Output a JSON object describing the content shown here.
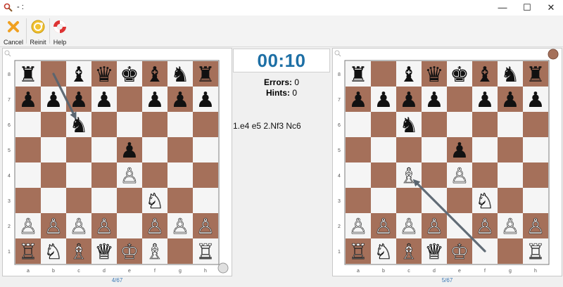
{
  "window": {
    "title": "- :",
    "minimize": "—",
    "maximize": "☐",
    "close": "✕"
  },
  "toolbar": {
    "cancel_label": "Cancel",
    "reinit_label": "Reinit",
    "help_label": "Help"
  },
  "timer": "00:10",
  "stats": {
    "errors_label": "Errors:",
    "errors_value": "0",
    "hints_label": "Hints:",
    "hints_value": "0"
  },
  "moves": "1.e4 e5 2.Nf3 Nc6",
  "files": [
    "a",
    "b",
    "c",
    "d",
    "e",
    "f",
    "g",
    "h"
  ],
  "ranks": [
    "8",
    "7",
    "6",
    "5",
    "4",
    "3",
    "2",
    "1"
  ],
  "colors": {
    "light": "#f5f5f5",
    "dark": "#a5705a",
    "arrow": "#5a6570",
    "accent": "#1d6fa5"
  },
  "left_board": {
    "page": "4/67",
    "position": [
      "r.bqkbnr",
      "pppp.ppp",
      "..n.....",
      "....p...",
      "....P...",
      ".....N..",
      "PPPP.PPP",
      "RNBQKB.R"
    ],
    "arrow": {
      "from": "b8",
      "to": "c6"
    }
  },
  "right_board": {
    "page": "5/67",
    "position": [
      "r.bqkbnr",
      "pppp.ppp",
      "..n.....",
      "....p...",
      "..B.P...",
      ".....N..",
      "PPPP.PPP",
      "RNBQK..R"
    ],
    "arrow": {
      "from": "f1",
      "to": "c4"
    }
  }
}
